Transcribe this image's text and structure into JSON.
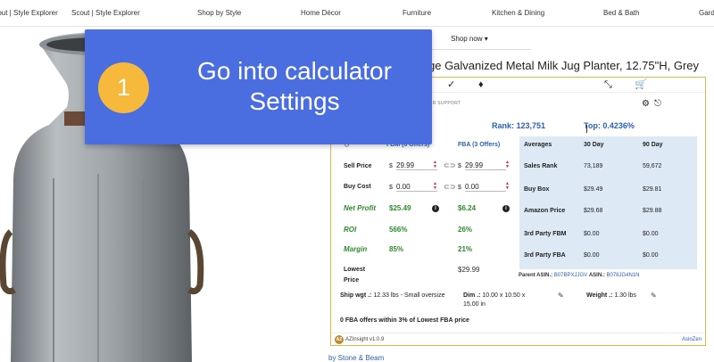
{
  "nav": {
    "items": [
      "Scout | Style Explorer",
      "Shop by Style",
      "Home Décor",
      "Furniture",
      "Kitchen & Dining",
      "Bed & Bath",
      "Gard"
    ]
  },
  "subnav": {
    "shop_now": "Shop now ▾"
  },
  "product": {
    "title": "ge Galvanized Metal Milk Jug Planter, 12.75\"H, Grey",
    "byline": "by Stone & Beam"
  },
  "overlay": {
    "step": "1",
    "line1": "Go into calculator",
    "line2": "Settings"
  },
  "panel": {
    "tabs_text": "ER     SUPPORT",
    "rank": "Rank: 123,751",
    "top": "Top: 0.4236%",
    "calc": {
      "fba_header": "FBA (3 Offers)",
      "fbm_header": "FBM (0 Offers)",
      "currency": "$",
      "sell_price_label": "Sell Price",
      "buy_cost_label": "Buy Cost",
      "net_profit_label": "Net Profit",
      "roi_label": "ROI",
      "margin_label": "Margin",
      "lowest_price_label": "Lowest Price",
      "fbm_sell": "29.99",
      "fba_sell": "29.99",
      "fbm_cost": "0.00",
      "fba_cost": "0.00",
      "fbm_profit": "$25.49",
      "fba_profit": "$6.24",
      "fbm_roi": "566%",
      "fba_roi": "26%",
      "fbm_margin": "85%",
      "fba_margin": "21%",
      "fba_lowest": "$29.99",
      "info": "i"
    },
    "averages": {
      "header": "Averages",
      "col30": "30 Day",
      "col90": "90 Day",
      "rows": [
        {
          "label": "Sales Rank",
          "d30": "73,189",
          "d90": "59,672"
        },
        {
          "label": "Buy Box",
          "d30": "$29.49",
          "d90": "$29.81"
        },
        {
          "label": "Amazon Price",
          "d30": "$29.68",
          "d90": "$29.88"
        },
        {
          "label": "3rd Party FBM",
          "d30": "$0.00",
          "d90": "$0.00"
        },
        {
          "label": "3rd Party FBA",
          "d30": "$0.00",
          "d90": "$0.00"
        }
      ]
    },
    "parent_asin_label": "Parent ASIN.:",
    "parent_asin": "B07BPXJJGV",
    "asin_label": "ASIN.:",
    "asin": "B078JG4N1N",
    "ship_label": "Ship wgt .:",
    "ship_value": "12.33 lbs - Small oversize",
    "dim_label": "Dim .:",
    "dim_value": "10.00 x 10.50 x 15.00 in",
    "weight_label": "Weight .:",
    "weight_value": "1.30 lbs",
    "offers_note": "0 FBA offers within 3% of Lowest FBA price",
    "footer_brand": "AZInsight v1.0.9",
    "footer_link": "AsinZen",
    "logo_text": "AZ"
  },
  "colors": {
    "overlay": "#4a6de0",
    "badge": "#f6b93b",
    "panel_border": "#e0b84a",
    "accent_blue": "#2b5fb4",
    "profit_green": "#2e8b2e",
    "averages_bg": "#dde9f5"
  },
  "icons": [
    "link-icon",
    "unlink-icon",
    "checkmark-icon",
    "fire-icon",
    "collapse-icon",
    "cart-icon",
    "gear-icon",
    "signout-icon",
    "edit-icon",
    "calculator-icon"
  ]
}
